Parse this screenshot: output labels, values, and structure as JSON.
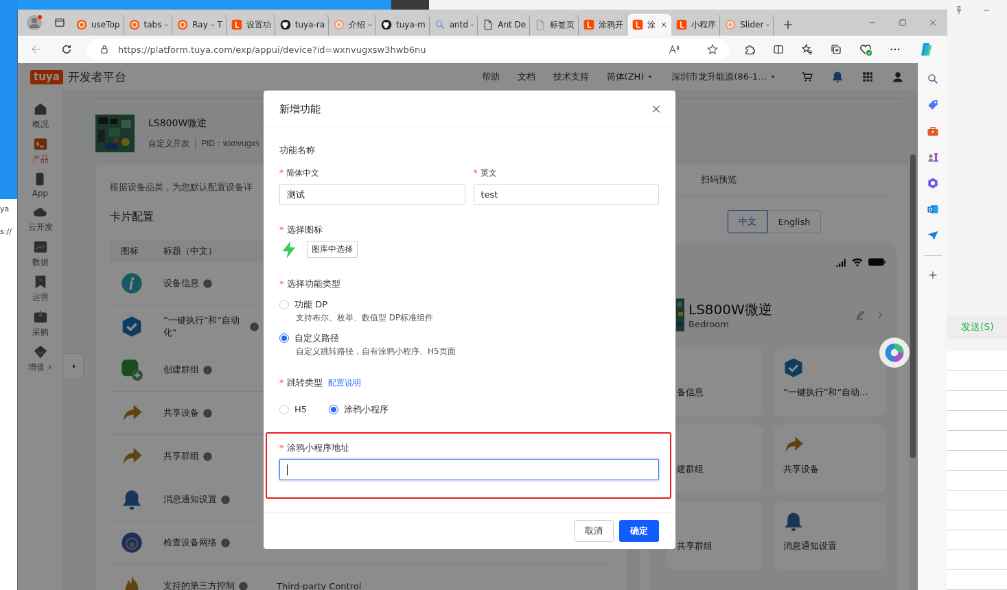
{
  "desktop": {
    "fragments": [
      "ya",
      "s://"
    ]
  },
  "browser": {
    "tabs": [
      {
        "title": "useTop",
        "kind": "ring",
        "selected": false
      },
      {
        "title": "tabs –",
        "kind": "ring",
        "selected": false
      },
      {
        "title": "Ray – T",
        "kind": "ring",
        "selected": false
      },
      {
        "title": "设置功",
        "kind": "app",
        "selected": false
      },
      {
        "title": "tuya-ra",
        "kind": "logo",
        "selected": false
      },
      {
        "title": "介绍 –",
        "kind": "ringfade",
        "selected": false
      },
      {
        "title": "tuya-m",
        "kind": "logo",
        "selected": false
      },
      {
        "title": "antd -",
        "kind": "search",
        "selected": false
      },
      {
        "title": "Ant De",
        "kind": "doc",
        "selected": false
      },
      {
        "title": "标签页",
        "kind": "docfade",
        "selected": false
      },
      {
        "title": "涂鸦开",
        "kind": "app",
        "selected": false
      },
      {
        "title": "涂",
        "kind": "app",
        "selected": true
      },
      {
        "title": "小程序",
        "kind": "app",
        "selected": false
      },
      {
        "title": "Slider -",
        "kind": "ringfade",
        "selected": false
      }
    ],
    "address": "https://platform.tuya.com/exp/appui/device?id=wxnvugxsw3hwb6nu"
  },
  "page": {
    "logo": "tuya",
    "platform": "开发者平台",
    "nav": [
      "帮助",
      "文档",
      "技术支持"
    ],
    "language": "简体(ZH)",
    "account": "深圳市龙升能源(86-1…",
    "sidebar": [
      {
        "label": "概况",
        "kind": "home",
        "selected": false
      },
      {
        "label": "产品",
        "kind": "terminal",
        "selected": true
      },
      {
        "label": "App",
        "kind": "phone",
        "selected": false
      },
      {
        "label": "云开发",
        "kind": "cloud",
        "selected": false
      },
      {
        "label": "数据",
        "kind": "chart",
        "selected": false
      },
      {
        "label": "运营",
        "kind": "bookmark",
        "selected": false
      },
      {
        "label": "采购",
        "kind": "box",
        "selected": false
      },
      {
        "label": "增值",
        "kind": "diamond",
        "selected": false,
        "external": true
      }
    ],
    "product": {
      "name": "LS800W微逆",
      "type": "自定义开发",
      "pid": "PID：wxnvugxs"
    },
    "card_config": {
      "intro": "根据设备品类，为您默认配置设备详",
      "title": "卡片配置",
      "columns": [
        "图标",
        "标题（中文）"
      ],
      "rows": [
        {
          "kind": "info",
          "title": "设备信息"
        },
        {
          "kind": "check",
          "title": "“一键执行”和“自动化”"
        },
        {
          "kind": "group",
          "title": "创建群组"
        },
        {
          "kind": "share",
          "title": "共享设备"
        },
        {
          "kind": "share",
          "title": "共享群组"
        },
        {
          "kind": "bell",
          "title": "消息通知设置"
        },
        {
          "kind": "network",
          "title": "检查设备网络"
        },
        {
          "kind": "flame",
          "title": "支持的第三方控制",
          "column_3": "Third-party Control"
        }
      ]
    },
    "preview": {
      "tabs": [
        {
          "label": "扫码预览",
          "selected": false
        }
      ],
      "languages": [
        {
          "label": "中文",
          "selected": true
        },
        {
          "label": "English",
          "selected": false
        }
      ],
      "device_name": "LS800W微逆",
      "room": "Bedroom",
      "cards": [
        {
          "label": "备信息"
        },
        {
          "label": "“一键执行”和“自动...",
          "kind": "check"
        },
        {
          "label": "建群组"
        },
        {
          "label": "共享设备",
          "kind": "share"
        },
        {
          "label": "共享群组"
        },
        {
          "label": "消息通知设置",
          "kind": "bell"
        }
      ]
    }
  },
  "modal": {
    "title": "新增功能",
    "required_mark": "*",
    "section": "功能名称",
    "name_fields": [
      {
        "label": "简体中文",
        "required": true,
        "value": "测试"
      },
      {
        "label": "英文",
        "required": true,
        "value": "test"
      }
    ],
    "icon_picker": {
      "label": "选择图标",
      "required": true,
      "button": "图库中选择"
    },
    "function_type": {
      "label": "选择功能类型",
      "required": true,
      "options": [
        {
          "label": "功能 DP",
          "description": "支持布尔、枚举、数值型 DP标准组件",
          "selected": false
        },
        {
          "label": "自定义路径",
          "description": "自定义跳转路径，自有涂鸦小程序、H5页面",
          "selected": true
        }
      ]
    },
    "jump_type": {
      "label": "跳转类型",
      "required": true,
      "link": "配置说明",
      "options": [
        {
          "label": "H5",
          "selected": false
        },
        {
          "label": "涂鸦小程序",
          "selected": true
        }
      ]
    },
    "address_field": {
      "label": "涂鸦小程序地址",
      "required": true,
      "focused": true,
      "highlighted": true
    },
    "buttons": [
      {
        "label": "取消",
        "kind": "default"
      },
      {
        "label": "确定",
        "kind": "primary"
      }
    ]
  },
  "other_window": {
    "send_button": "发送(S)"
  }
}
